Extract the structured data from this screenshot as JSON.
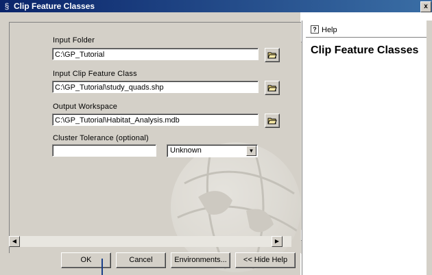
{
  "window": {
    "title": "Clip Feature Classes",
    "close_glyph": "x"
  },
  "form": {
    "input_folder": {
      "label": "Input Folder",
      "value": "C:\\GP_Tutorial"
    },
    "input_clip": {
      "label": "Input Clip Feature Class",
      "value": "C:\\GP_Tutorial\\study_quads.shp"
    },
    "output_workspace": {
      "label": "Output Workspace",
      "value": "C:\\GP_Tutorial\\Habitat_Analysis.mdb"
    },
    "cluster_tolerance": {
      "label": "Cluster Tolerance (optional)",
      "value": "",
      "unit": "Unknown"
    }
  },
  "buttons": {
    "ok": "OK",
    "cancel": "Cancel",
    "environments": "Environments...",
    "hide_help": "<< Hide Help"
  },
  "help": {
    "tab_label": "Help",
    "title": "Clip Feature Classes"
  },
  "icons": {
    "app": "toolbox-icon",
    "browse": "open-folder-icon",
    "help": "help-icon"
  },
  "colors": {
    "titlebar": "#0a246a",
    "dialog": "#d4d0c8",
    "pointer": "#1a3f8a"
  }
}
